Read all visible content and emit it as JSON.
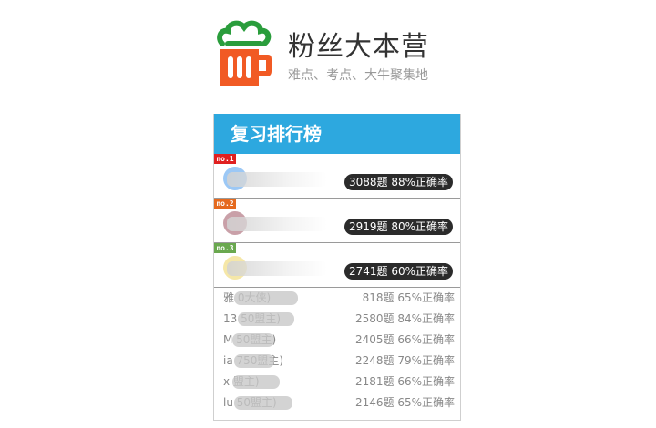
{
  "brand": {
    "title": "粉丝大本营",
    "slogan": "难点、考点、大牛聚集地",
    "logo_icon": "beer-mug-cloud-icon",
    "colors": {
      "cloud": "#2a9d3c",
      "mug": "#f15a24"
    }
  },
  "panel": {
    "title": "复习排行榜",
    "header_color": "#2da8df",
    "top_ranks": [
      {
        "badge": "no.1",
        "badge_color": "#e02020",
        "avatar_color": "#9cc8f5",
        "stat": "3088题 88%正确率"
      },
      {
        "badge": "no.2",
        "badge_color": "#e56a1f",
        "avatar_color": "#c9a0a8",
        "stat": "2919题 80%正确率"
      },
      {
        "badge": "no.3",
        "badge_color": "#6aa84f",
        "avatar_color": "#f5e7a8",
        "stat": "2741题 60%正确率"
      }
    ],
    "list": [
      {
        "name": "雅                0大侠)",
        "stat": "818题 65%正确率"
      },
      {
        "name": "13                50盟主)",
        "stat": "2580题 84%正确率"
      },
      {
        "name": "M            50盟主)",
        "stat": "2405题 66%正确率"
      },
      {
        "name": "ia            750盟主)",
        "stat": "2248题 79%正确率"
      },
      {
        "name": "x               盟主)",
        "stat": "2181题 66%正确率"
      },
      {
        "name": "lu                50盟主)",
        "stat": "2146题 65%正确率"
      }
    ]
  }
}
